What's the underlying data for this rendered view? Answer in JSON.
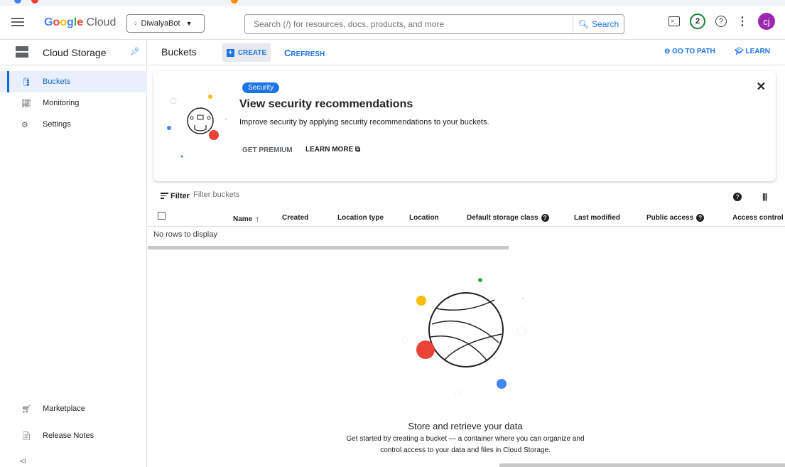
{
  "app": {
    "brand_google": "Google",
    "brand_cloud": "Cloud",
    "project": "DiwalyaBot"
  },
  "search": {
    "placeholder": "Search (/) for resources, docs, products, and more",
    "button": "Search"
  },
  "topbar": {
    "notifications": "2",
    "avatar_initials": "cj"
  },
  "sidebar": {
    "title": "Cloud Storage",
    "items": [
      {
        "label": "Buckets",
        "icon": "bucket-icon",
        "active": true
      },
      {
        "label": "Monitoring",
        "icon": "monitoring-icon",
        "active": false
      },
      {
        "label": "Settings",
        "icon": "settings-icon",
        "active": false
      }
    ],
    "footer": [
      {
        "label": "Marketplace",
        "icon": "marketplace-icon"
      },
      {
        "label": "Release Notes",
        "icon": "release-notes-icon"
      }
    ],
    "collapse": "<I"
  },
  "header": {
    "title": "Buckets",
    "create": "CREATE",
    "refresh": "REFRESH",
    "goto_path": "GO TO PATH",
    "learn": "LEARN"
  },
  "security": {
    "badge": "Security",
    "title": "View security recommendations",
    "description": "Improve security by applying security recommendations to your buckets.",
    "premium": "GET PREMIUM",
    "learn_more": "LEARN MORE"
  },
  "filter": {
    "label": "Filter",
    "placeholder": "Filter buckets"
  },
  "table": {
    "columns": [
      "Name",
      "Created",
      "Location type",
      "Location",
      "Default storage class",
      "Last modified",
      "Public access",
      "Access control"
    ],
    "empty": "No rows to display"
  },
  "empty_state": {
    "title": "Store and retrieve your data",
    "line1": "Get started by creating a bucket — a container where you can organize and",
    "line2": "control access to your data and files in Cloud Storage."
  },
  "colors": {
    "accent": "#1a73e8",
    "active_bg": "#e8f0fe",
    "red": "#ea4335",
    "yellow": "#fbbc04",
    "green": "#34a853",
    "blue": "#4285f4"
  }
}
